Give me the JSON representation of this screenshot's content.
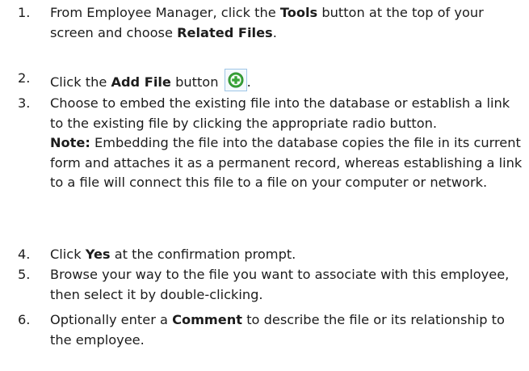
{
  "steps": [
    {
      "number": "1.",
      "text_a": "From Employee Manager, click the ",
      "bold_a": "Tools",
      "text_b": " button at the top of your screen and choose ",
      "bold_b": "Related Files",
      "text_c": "."
    },
    {
      "number": "2.",
      "text_a": "Click the ",
      "bold_a": "Add File",
      "text_b": " button ",
      "icon": "add-circle-icon",
      "text_c": "."
    },
    {
      "number": "3.",
      "text_a": "Choose to embed the existing file into the database or establish a link to the existing file by clicking the appropriate radio button.",
      "note_label": "Note:",
      "note_text": " Embedding the file into the database copies the file in its current form and attaches it as a permanent record, whereas establishing a link to a file will connect this file to a file on your computer or network."
    },
    {
      "number": "4.",
      "text_a": "Click ",
      "bold_a": "Yes",
      "text_b": " at the confirmation prompt."
    },
    {
      "number": "5.",
      "text_a": "Browse your way to the file you want to associate with this employee, then select it by double-clicking."
    },
    {
      "number": "6.",
      "text_a": "Optionally enter a ",
      "bold_a": "Comment",
      "text_b": " to describe the file or its relationship to the employee."
    }
  ],
  "colors": {
    "text": "#1c1c1c",
    "icon_green": "#3aa53a",
    "icon_border": "#9fc6e6"
  }
}
